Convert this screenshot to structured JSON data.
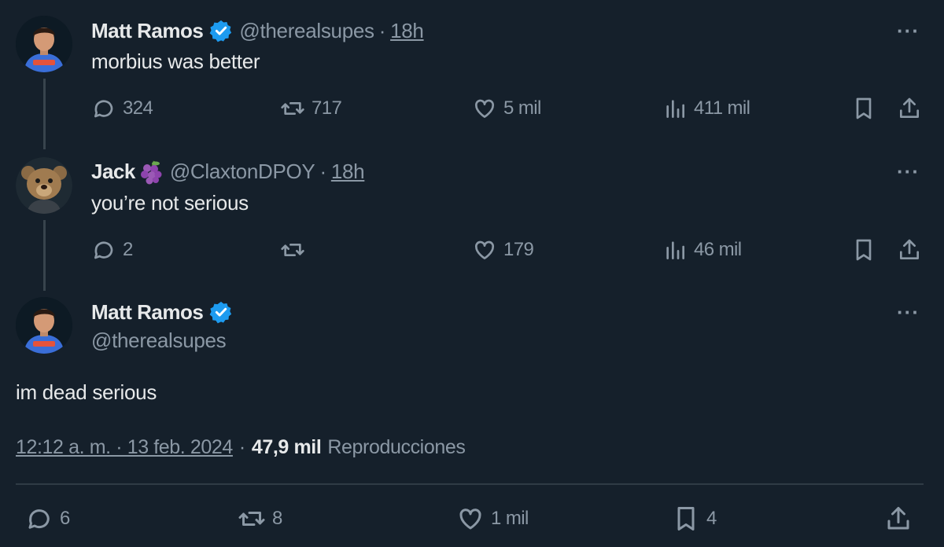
{
  "colors": {
    "background": "#15202b",
    "text": "#e7e9ea",
    "muted": "#8b98a5",
    "verified": "#1d9bf0"
  },
  "tweets": [
    {
      "name": "Matt Ramos",
      "handle": "@therealsupes",
      "separator": "·",
      "time": "18h",
      "text": "morbius was better",
      "avatar_icon": "person-avatar",
      "actions": {
        "replies": "324",
        "retweets": "717",
        "likes": "5 mil",
        "views": "411 mil"
      }
    },
    {
      "name": "Jack",
      "handle": "@ClaxtonDPOY",
      "separator": "·",
      "time": "18h",
      "text": "you’re not serious",
      "avatar_icon": "teddy-bear-avatar",
      "name_emoji": "grapes-emoji",
      "actions": {
        "replies": "2",
        "retweets": "",
        "likes": "179",
        "views": "46 mil"
      }
    }
  ],
  "main": {
    "name": "Matt Ramos",
    "handle": "@therealsupes",
    "text": "im dead serious",
    "timestamp": "12:12 a. m. · 13 feb. 2024",
    "separator": "·",
    "views_count": "47,9 mil",
    "views_label": "Reproducciones",
    "actions": {
      "replies": "6",
      "retweets": "8",
      "likes": "1 mil",
      "bookmarks": "4"
    }
  },
  "more_label": "···"
}
